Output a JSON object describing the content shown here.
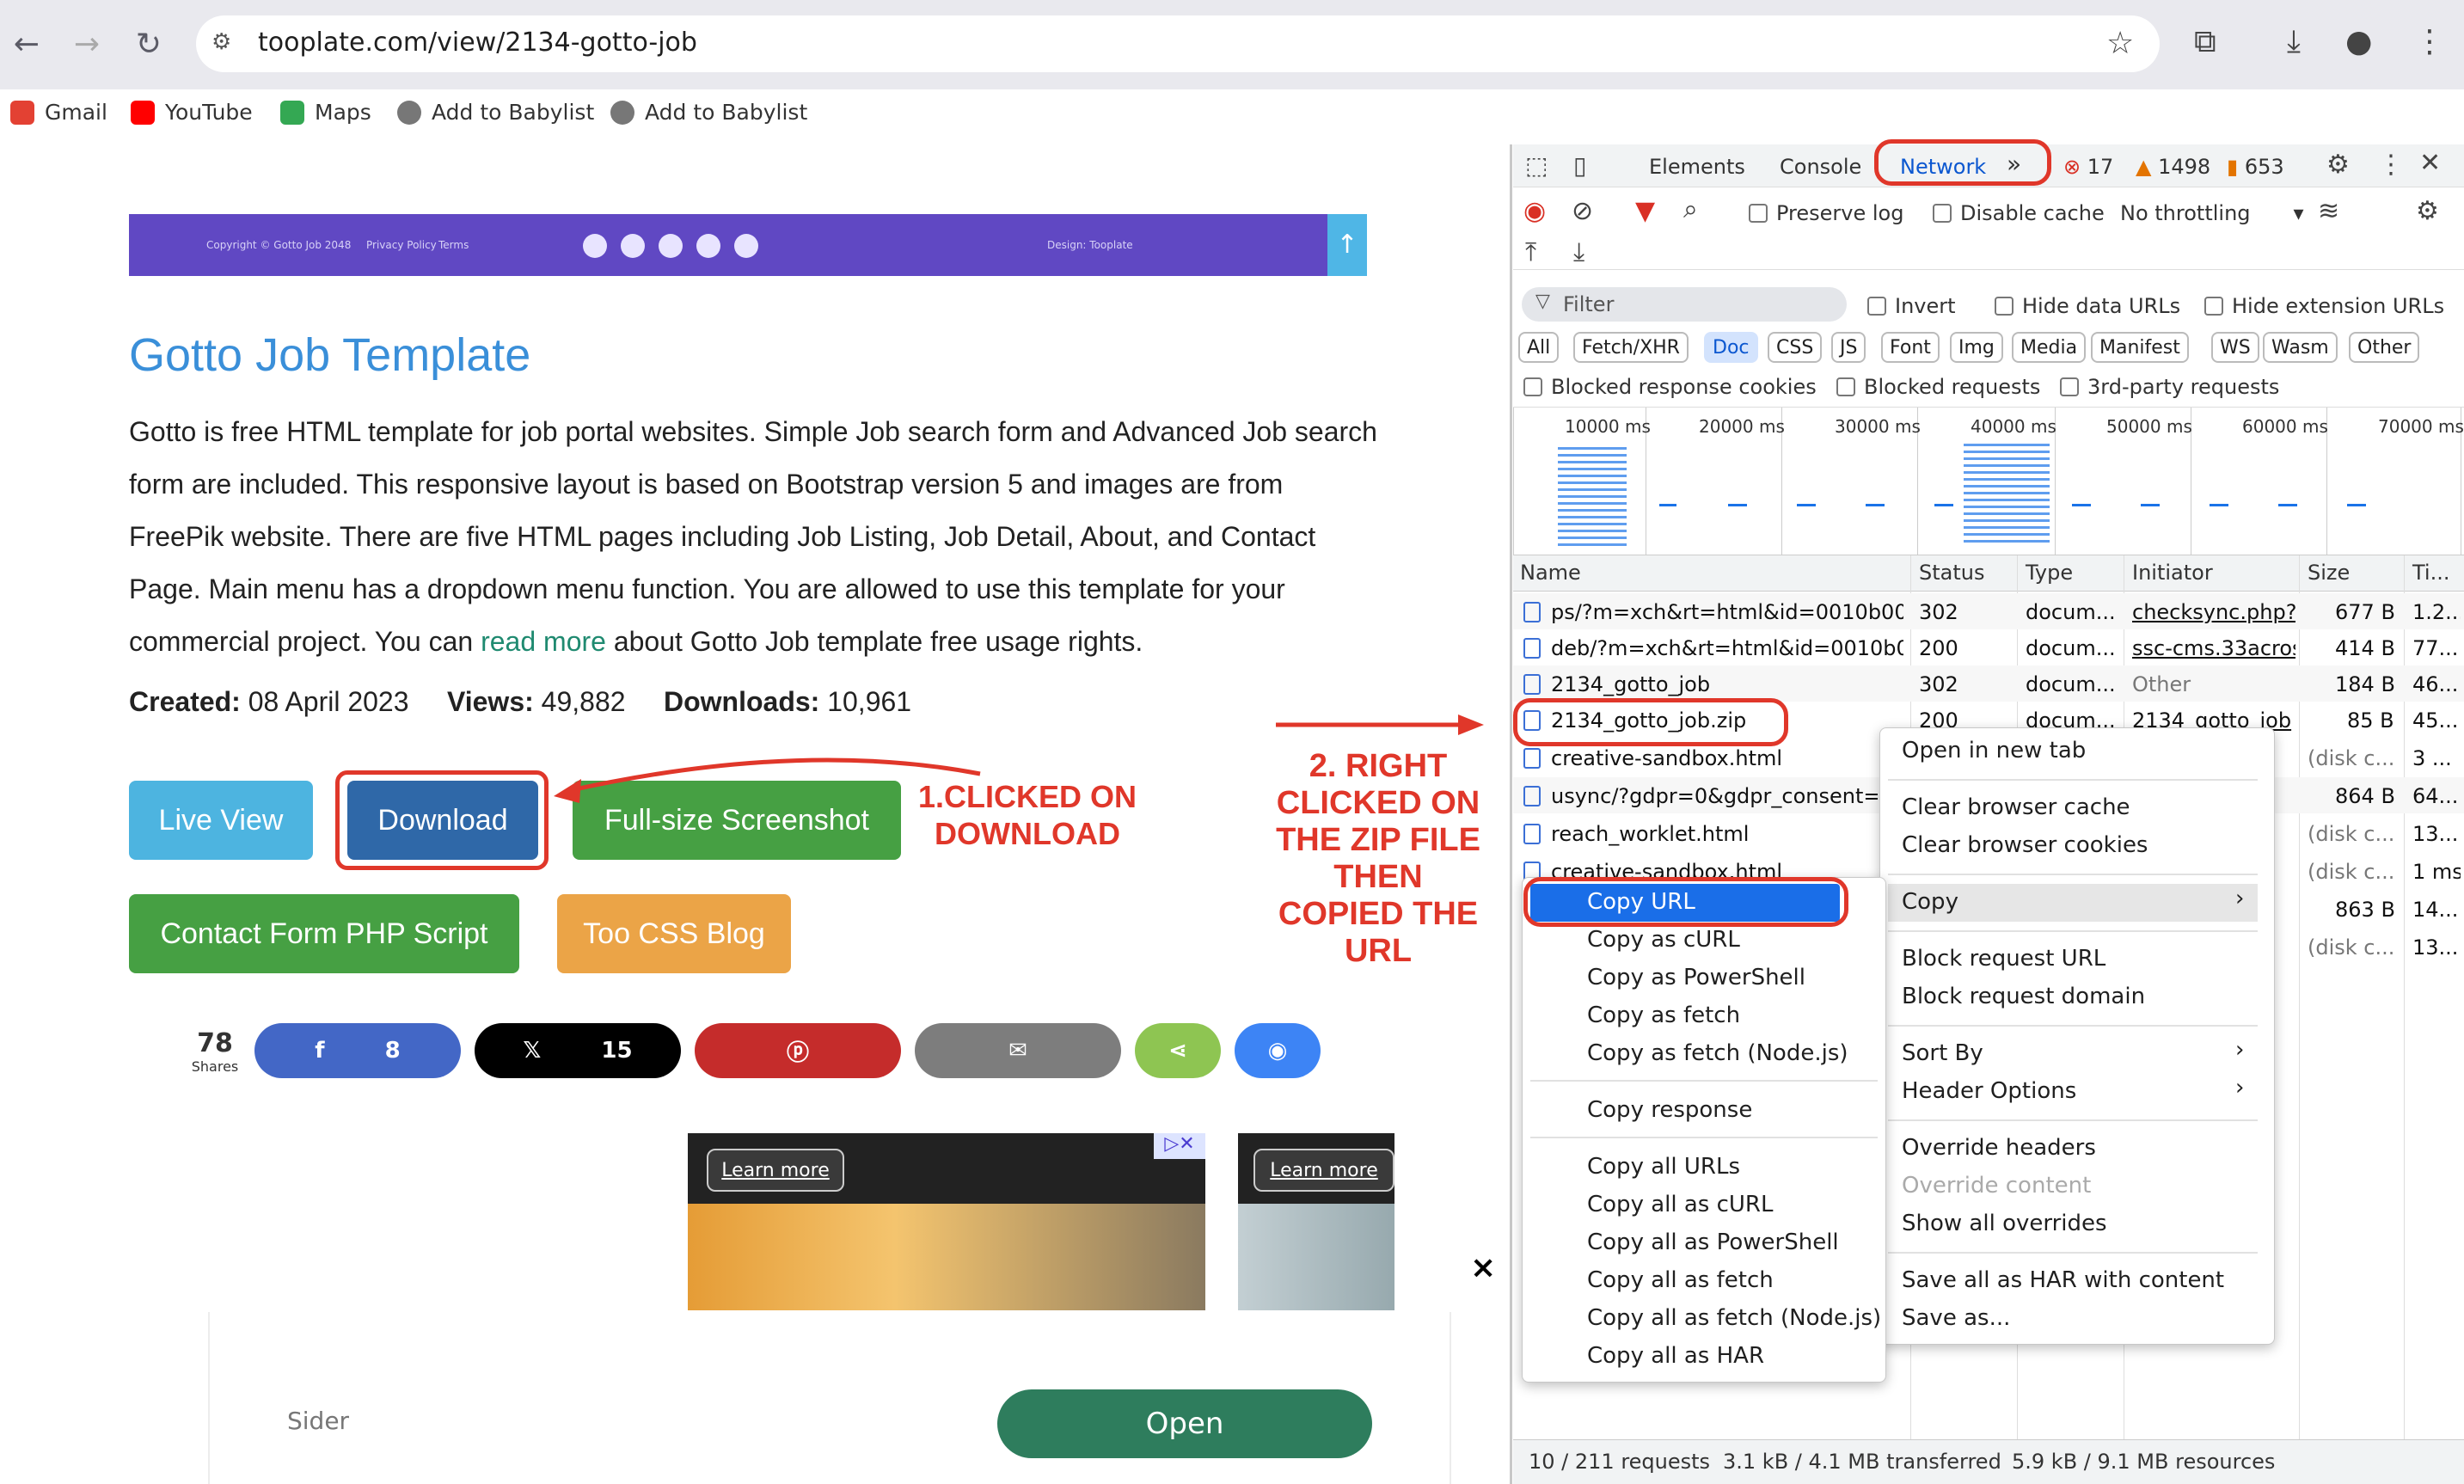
{
  "browser": {
    "url": "tooplate.com/view/2134-gotto-job",
    "bookmarks": [
      "Gmail",
      "YouTube",
      "Maps",
      "Add to Babylist",
      "Add to Babylist"
    ]
  },
  "page": {
    "footer_banner": {
      "copyright": "Copyright © Gotto Job 2048",
      "privacy": "Privacy Policy",
      "terms": "Terms",
      "design": "Design: Tooplate"
    },
    "title": "Gotto Job Template",
    "description_before_link": "Gotto is free HTML template for job portal websites. Simple Job search form and Advanced Job search form are included. This responsive layout is based on Bootstrap version 5 and images are from FreePik website. There are five HTML pages including Job Listing, Job Detail, About, and Contact Page. Main menu has a dropdown menu function. You are allowed to use this template for your commercial project. You can ",
    "description_link": "read more",
    "description_after_link": " about Gotto Job template free usage rights.",
    "stats": {
      "created_label": "Created:",
      "created": "08 April 2023",
      "views_label": "Views:",
      "views": "49,882",
      "downloads_label": "Downloads:",
      "downloads": "10,961"
    },
    "buttons": {
      "live_view": "Live View",
      "download": "Download",
      "screenshot": "Full-size Screenshot",
      "contact_php": "Contact Form PHP Script",
      "css_blog": "Too CSS Blog"
    },
    "share": {
      "count": "78",
      "label": "Shares",
      "facebook": "8",
      "x": "15"
    },
    "ads": {
      "learn_more_1": "Learn more",
      "learn_more_2": "Learn more",
      "close": "×"
    },
    "sider": {
      "label": "Sider",
      "open": "Open"
    }
  },
  "annotations": {
    "note1": "1.CLICKED ON DOWNLOAD",
    "note2": "2. RIGHT CLICKED ON THE ZIP FILE THEN COPIED THE URL"
  },
  "devtools": {
    "tabs": [
      "Elements",
      "Console",
      "Network"
    ],
    "errors": "17",
    "warnings": "1498",
    "issues": "653",
    "preserve_log": "Preserve log",
    "disable_cache": "Disable cache",
    "throttling": "No throttling",
    "filter_placeholder": "Filter",
    "invert": "Invert",
    "hide_data_urls": "Hide data URLs",
    "hide_ext_urls": "Hide extension URLs",
    "types": [
      "All",
      "Fetch/XHR",
      "Doc",
      "CSS",
      "JS",
      "Font",
      "Img",
      "Media",
      "Manifest",
      "WS",
      "Wasm",
      "Other"
    ],
    "blocked_cookies": "Blocked response cookies",
    "blocked_requests": "Blocked requests",
    "third_party": "3rd-party requests",
    "timeline_labels": [
      "10000 ms",
      "20000 ms",
      "30000 ms",
      "40000 ms",
      "50000 ms",
      "60000 ms",
      "70000 ms"
    ],
    "columns": [
      "Name",
      "Status",
      "Type",
      "Initiator",
      "Size",
      "Ti..."
    ],
    "rows": [
      {
        "name": "ps/?m=xch&rt=html&id=0010b00...",
        "status": "302",
        "type": "docum...",
        "initiator": "checksync.php?v",
        "size": "677 B",
        "time": "1.2..."
      },
      {
        "name": "deb/?m=xch&rt=html&id=0010b0...",
        "status": "200",
        "type": "docum...",
        "initiator": "ssc-cms.33acros",
        "size": "414 B",
        "time": "77..."
      },
      {
        "name": "2134_gotto_job",
        "status": "302",
        "type": "docum...",
        "initiator": "Other",
        "size": "184 B",
        "time": "46..."
      },
      {
        "name": "2134_gotto_job.zip",
        "status": "200",
        "type": "docum...",
        "initiator": "2134_gotto_job",
        "size": "85 B",
        "time": "45..."
      },
      {
        "name": "creative-sandbox.html",
        "status": "",
        "type": "",
        "initiator": "",
        "size": "(disk c...",
        "time": "3 ..."
      },
      {
        "name": "usync/?gdpr=0&gdpr_consent=&",
        "status": "",
        "type": "",
        "initiator": "",
        "size": "864 B",
        "time": "64..."
      },
      {
        "name": "reach_worklet.html",
        "status": "",
        "type": "",
        "initiator": "",
        "size": "(disk c...",
        "time": "13..."
      },
      {
        "name": "creative-sandbox.html",
        "status": "",
        "type": "",
        "initiator": "",
        "size": "(disk c...",
        "time": "1 ms"
      },
      {
        "name": "u",
        "status": "",
        "type": "",
        "initiator": "",
        "size": "863 B",
        "time": "14..."
      },
      {
        "name": "re",
        "status": "",
        "type": "",
        "initiator": "",
        "size": "(disk c...",
        "time": "13..."
      }
    ],
    "status_bar": {
      "requests": "10 / 211 requests",
      "transferred": "3.1 kB / 4.1 MB transferred",
      "resources": "5.9 kB / 9.1 MB resources"
    }
  },
  "context_menu": {
    "open_new_tab": "Open in new tab",
    "clear_cache": "Clear browser cache",
    "clear_cookies": "Clear browser cookies",
    "copy": "Copy",
    "block_url": "Block request URL",
    "block_domain": "Block request domain",
    "sort_by": "Sort By",
    "header_options": "Header Options",
    "override_headers": "Override headers",
    "override_content": "Override content",
    "show_overrides": "Show all overrides",
    "save_har": "Save all as HAR with content",
    "save_as": "Save as..."
  },
  "copy_submenu": {
    "copy_url": "Copy URL",
    "copy_curl": "Copy as cURL",
    "copy_powershell": "Copy as PowerShell",
    "copy_fetch": "Copy as fetch",
    "copy_fetch_node": "Copy as fetch (Node.js)",
    "copy_response": "Copy response",
    "copy_all_urls": "Copy all URLs",
    "copy_all_curl": "Copy all as cURL",
    "copy_all_powershell": "Copy all as PowerShell",
    "copy_all_fetch": "Copy all as fetch",
    "copy_all_fetch_node": "Copy all as fetch (Node.js)",
    "copy_all_har": "Copy all as HAR"
  },
  "colors": {
    "accent_red": "#e0372a",
    "title_blue": "#3a8fd9",
    "devtools_blue": "#1a6ee8"
  }
}
